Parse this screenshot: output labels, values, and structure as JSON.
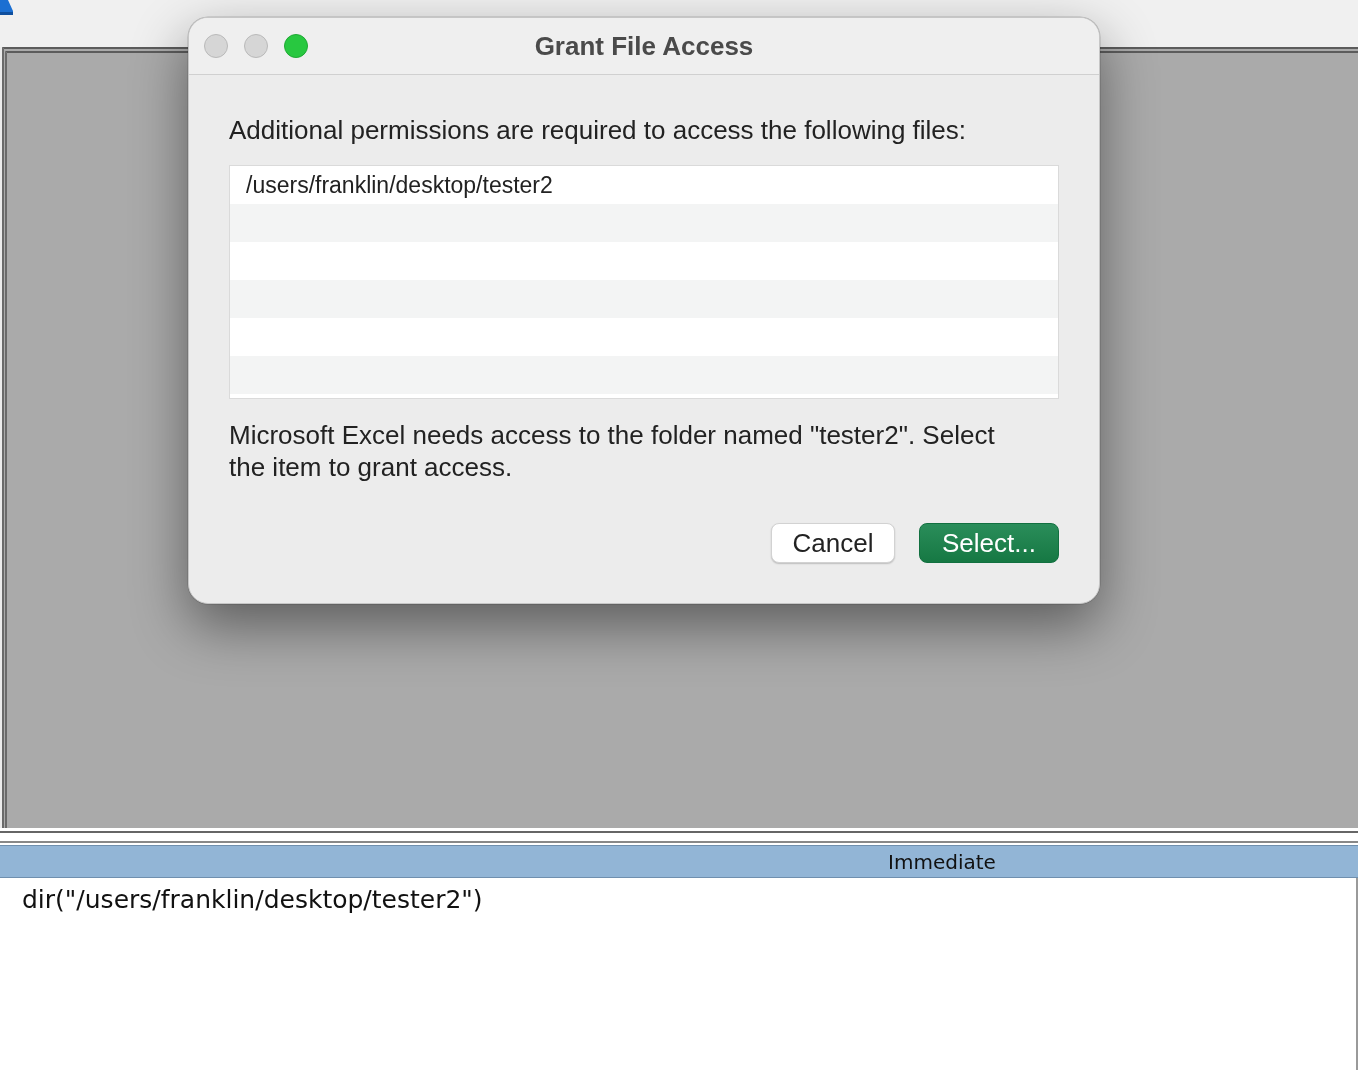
{
  "immediate_pane": {
    "title": "Immediate",
    "lines": [
      "dir(\"/users/franklin/desktop/tester2\")"
    ]
  },
  "dialog": {
    "title": "Grant File Access",
    "window_controls": [
      {
        "kind": "close",
        "disabled": true
      },
      {
        "kind": "minimize",
        "disabled": true
      },
      {
        "kind": "zoom",
        "disabled": false
      }
    ],
    "prompt": "Additional permissions are required to access the following files:",
    "files": [
      {
        "path": "/users/franklin/desktop/tester2",
        "selected": false
      }
    ],
    "message": "Microsoft Excel needs access to the folder named \"tester2\". Select the item to grant access.",
    "buttons": [
      {
        "label": "Cancel",
        "kind": "secondary"
      },
      {
        "label": "Select...",
        "kind": "primary"
      }
    ]
  }
}
